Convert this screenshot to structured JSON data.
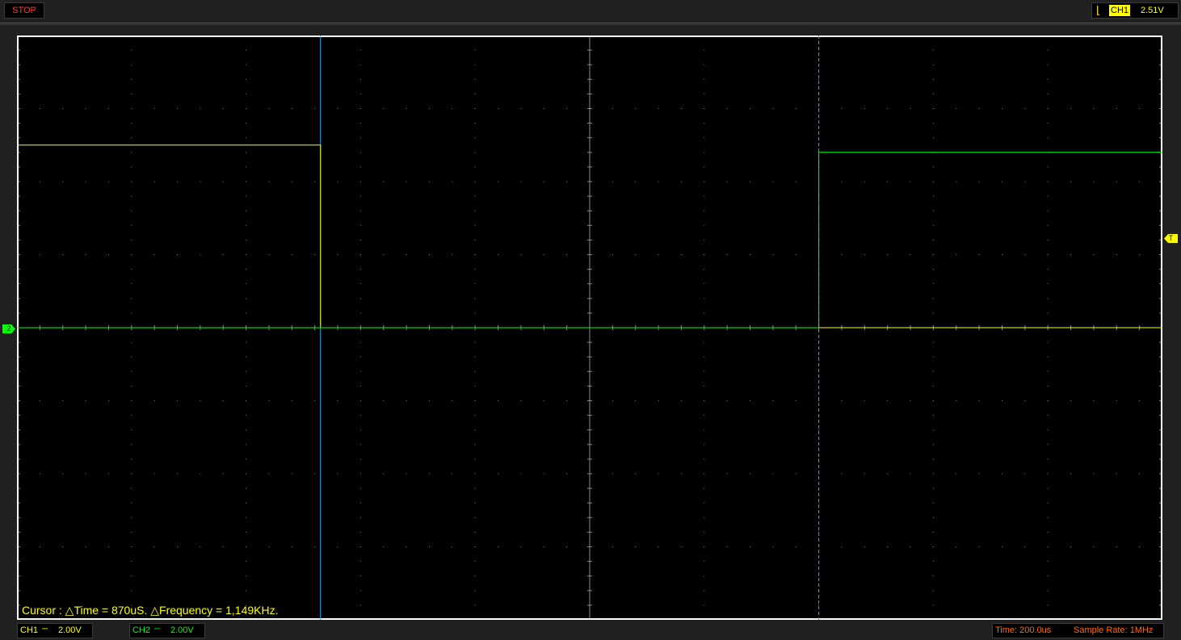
{
  "status": {
    "run_state": "STOP"
  },
  "trigger": {
    "edge_icon": "falling-edge-icon",
    "channel": "CH1",
    "level": "2.51V"
  },
  "channels": {
    "ch1": {
      "label": "CH1",
      "coupling": "⎓",
      "volts_div": "2.00V",
      "color": "#ffff00"
    },
    "ch2": {
      "label": "CH2",
      "coupling": "⎓",
      "volts_div": "2.00V",
      "color": "#00ff00"
    }
  },
  "markers": {
    "ch2_ground": "2",
    "trigger_level": "T"
  },
  "cursor": {
    "readout": "Cursor : △Time = 870uS. △Frequency = 1,149KHz."
  },
  "timebase": {
    "time_div": "Time: 200.0us",
    "sample_rate": "Sample Rate: 1MHz"
  },
  "colors": {
    "grid": "#7a7a7a",
    "cursor": "#2aa9ff",
    "background": "#000000"
  },
  "chart_data": {
    "type": "line",
    "x_unit": "us",
    "xlim": [
      0,
      2000
    ],
    "ylim": [
      -8,
      8
    ],
    "grid_divisions": {
      "x": 10,
      "y": 8
    },
    "series": [
      {
        "name": "CH1",
        "x": [
          0,
          530,
          530,
          2000
        ],
        "y": [
          5.0,
          5.0,
          0.0,
          0.0
        ]
      },
      {
        "name": "CH2",
        "x": [
          0,
          1400,
          1400,
          2000
        ],
        "y": [
          0.0,
          0.0,
          4.8,
          4.8
        ]
      }
    ],
    "cursors": {
      "x1_us": 530,
      "x2_us": 1400,
      "delta_us": 870
    }
  }
}
